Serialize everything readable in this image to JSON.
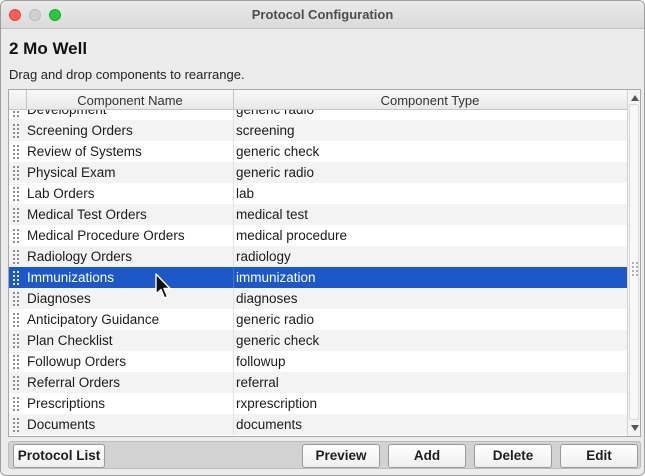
{
  "window": {
    "title": "Protocol Configuration",
    "controls": [
      "close",
      "minimize",
      "maximize"
    ]
  },
  "protocol": {
    "name": "2 Mo Well",
    "instructions": "Drag and drop components to rearrange."
  },
  "table": {
    "columns": [
      "Component Name",
      "Component Type"
    ],
    "rows": [
      {
        "name": "Development",
        "type": "generic radio"
      },
      {
        "name": "Screening Orders",
        "type": "screening"
      },
      {
        "name": "Review of Systems",
        "type": "generic check"
      },
      {
        "name": "Physical Exam",
        "type": "generic radio"
      },
      {
        "name": "Lab Orders",
        "type": "lab"
      },
      {
        "name": "Medical Test Orders",
        "type": "medical test"
      },
      {
        "name": "Medical Procedure Orders",
        "type": "medical procedure"
      },
      {
        "name": "Radiology Orders",
        "type": "radiology"
      },
      {
        "name": "Immunizations",
        "type": "immunization"
      },
      {
        "name": "Diagnoses",
        "type": "diagnoses"
      },
      {
        "name": "Anticipatory Guidance",
        "type": "generic radio"
      },
      {
        "name": "Plan Checklist",
        "type": "generic check"
      },
      {
        "name": "Followup Orders",
        "type": "followup"
      },
      {
        "name": "Referral Orders",
        "type": "referral"
      },
      {
        "name": "Prescriptions",
        "type": "rxprescription"
      },
      {
        "name": "Documents",
        "type": "documents"
      }
    ],
    "selected_row_index": 8,
    "selection_color": "#1c58c8"
  },
  "buttons": {
    "protocol_list": "Protocol List",
    "preview": "Preview",
    "add": "Add",
    "delete": "Delete",
    "edit": "Edit"
  },
  "icons": {
    "row_handle": "drag-handle-icon",
    "cursor": "arrow-cursor-icon"
  }
}
